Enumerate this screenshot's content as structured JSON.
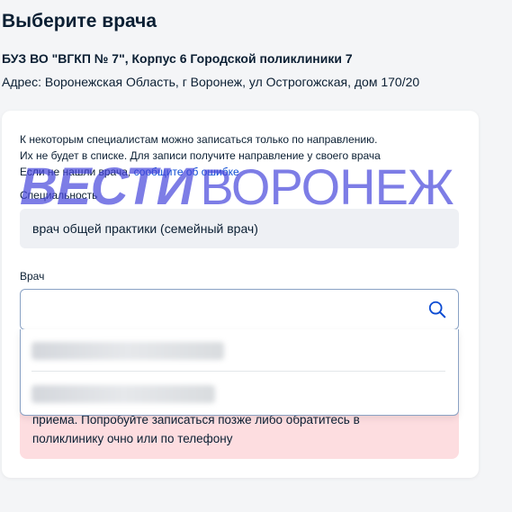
{
  "page": {
    "title": "Выберите врача",
    "org_name": "БУЗ ВО \"ВГКП № 7\", Корпус 6 Городской поликлиники 7",
    "org_address": "Адрес: Воронежская Область, г Воронеж, ул Острогожская, дом 170/20"
  },
  "notice": {
    "line1": "К некоторым специалистам можно записаться только по направлению.",
    "line2": "Их не будет в списке. Для записи получите направление у своего врача",
    "line3_prefix": "Если не нашли врача,",
    "line3_link": "сообщите об ошибке"
  },
  "specialty": {
    "label": "Специальность",
    "value": "врач общей практики (семейный врач)"
  },
  "doctor": {
    "label": "Врач",
    "value": "",
    "placeholder": ""
  },
  "error": {
    "line1": "приема. Попробуйте записаться позже либо обратитесь в",
    "line2": "поликлинику очно или по телефону"
  },
  "watermark": {
    "bold": "ВЕСТИ",
    "thin": "ВОРОНЕЖ"
  },
  "icons": {
    "search": "search-icon"
  },
  "colors": {
    "link": "#0d4cd3",
    "error_bg": "#fddde0",
    "field_bg": "#eef0f4",
    "watermark": "#4646dc"
  }
}
